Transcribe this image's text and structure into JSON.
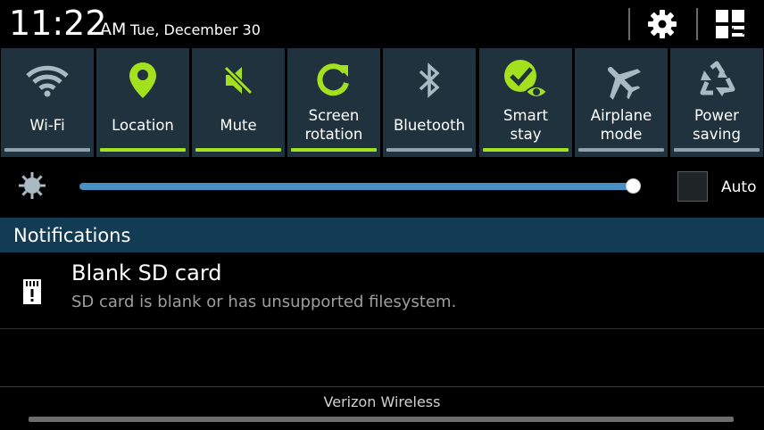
{
  "status": {
    "time": "11:22",
    "ampm": "AM",
    "date": "Tue, December 30"
  },
  "header_icons": {
    "settings": "gear-icon",
    "grid": "quick-panel-grid-icon"
  },
  "colors": {
    "tile_bg": "#1f323d",
    "accent_on": "#a3e11f",
    "indicator_off": "#8fa1ab",
    "slider": "#4a8fc4",
    "notif_header": "#123c53"
  },
  "quick_settings": [
    {
      "label": "Wi-Fi",
      "icon": "wifi-icon",
      "on": false
    },
    {
      "label": "Location",
      "icon": "location-pin-icon",
      "on": true
    },
    {
      "label": "Mute",
      "icon": "mute-icon",
      "on": true
    },
    {
      "label": "Screen\nrotation",
      "icon": "rotation-icon",
      "on": true
    },
    {
      "label": "Bluetooth",
      "icon": "bluetooth-icon",
      "on": false
    },
    {
      "label": "Smart\nstay",
      "icon": "smart-stay-icon",
      "on": true
    },
    {
      "label": "Airplane\nmode",
      "icon": "airplane-icon",
      "on": false
    },
    {
      "label": "Power\nsaving",
      "icon": "power-saving-icon",
      "on": false
    }
  ],
  "brightness": {
    "level": 0.99,
    "auto_label": "Auto",
    "auto_checked": false
  },
  "notifications": {
    "header": "Notifications",
    "items": [
      {
        "icon": "sd-card-alert-icon",
        "title": "Blank SD card",
        "text": "SD card is blank or has unsupported filesystem."
      }
    ]
  },
  "footer": {
    "carrier": "Verizon Wireless"
  }
}
